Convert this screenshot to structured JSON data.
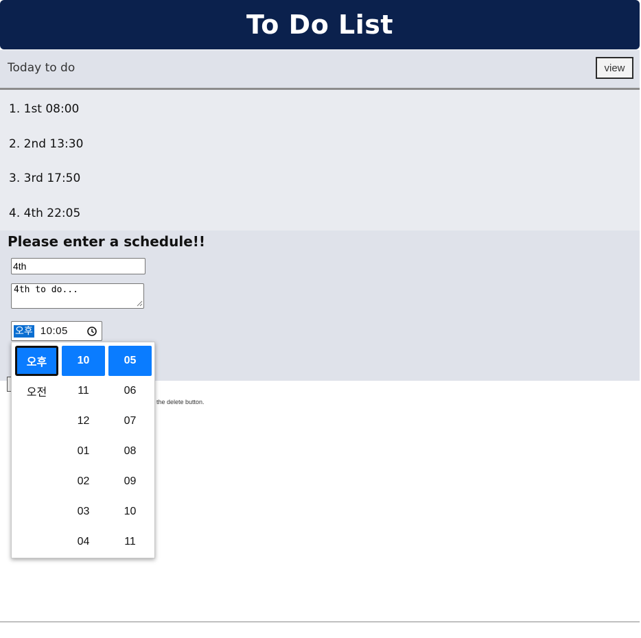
{
  "header": {
    "title": "To Do List"
  },
  "today": {
    "label": "Today to do",
    "view_button": "view"
  },
  "list": [
    "1. 1st 08:00",
    "2. 2nd 13:30",
    "3. 3rd 17:50",
    "4. 4th 22:05"
  ],
  "form": {
    "heading": "Please enter a schedule!!",
    "title_value": "4th",
    "desc_value": "4th to do...",
    "time": {
      "ampm": "오후",
      "hour_minute": "10:05"
    },
    "help_text": "the delete button."
  },
  "picker": {
    "ampm": [
      "오후",
      "오전"
    ],
    "hours": [
      "10",
      "11",
      "12",
      "01",
      "02",
      "03",
      "04"
    ],
    "minutes": [
      "05",
      "06",
      "07",
      "08",
      "09",
      "10",
      "11"
    ],
    "selected": {
      "ampm": "오후",
      "hour": "10",
      "minute": "05"
    }
  },
  "colors": {
    "header_bg": "#0b214d",
    "accent": "#0a7cff",
    "panel": "#dfe2ea",
    "list_bg": "#e9ebf0"
  },
  "icons": {
    "time": "clock-icon"
  }
}
